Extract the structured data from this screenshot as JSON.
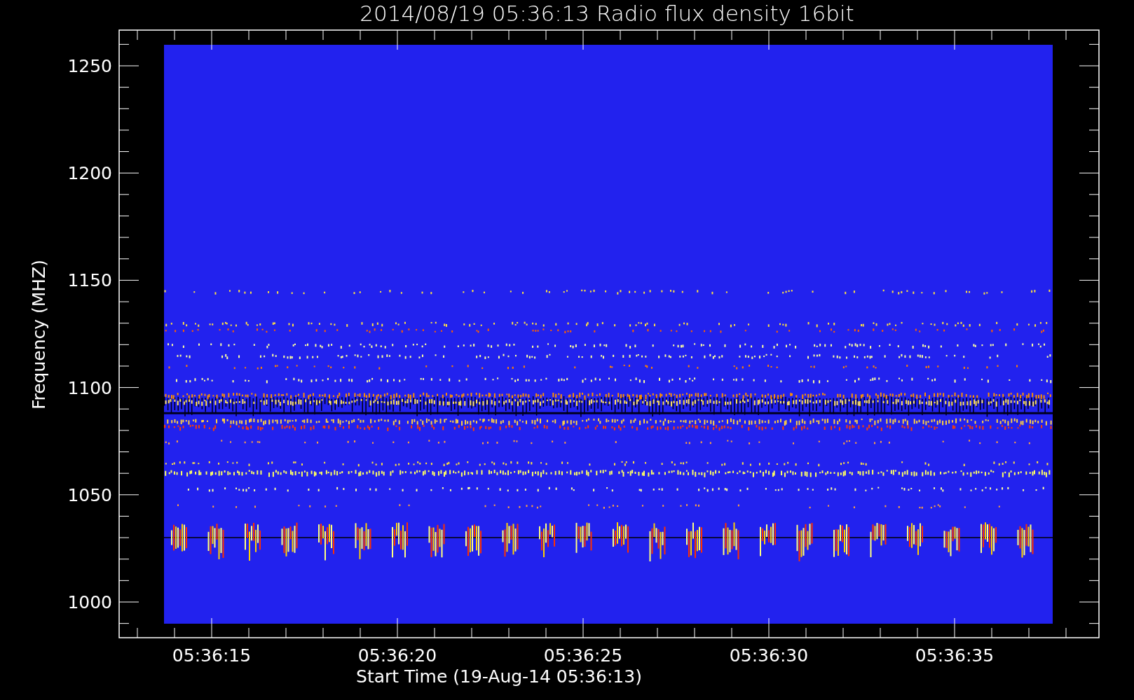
{
  "title": "2014/08/19 05:36:13 Radio flux density 16bit",
  "plot": {
    "y_axis": {
      "label": "Frequency (MHZ)",
      "ticks": [
        "1250",
        "1200",
        "1150",
        "1100",
        "1050",
        "1000"
      ]
    },
    "x_axis": {
      "label": "Start Time (19-Aug-14 05:36:13)",
      "ticks": [
        "05:36:15",
        "05:36:20",
        "05:36:25",
        "05:36:30",
        "05:36:35"
      ]
    }
  }
}
